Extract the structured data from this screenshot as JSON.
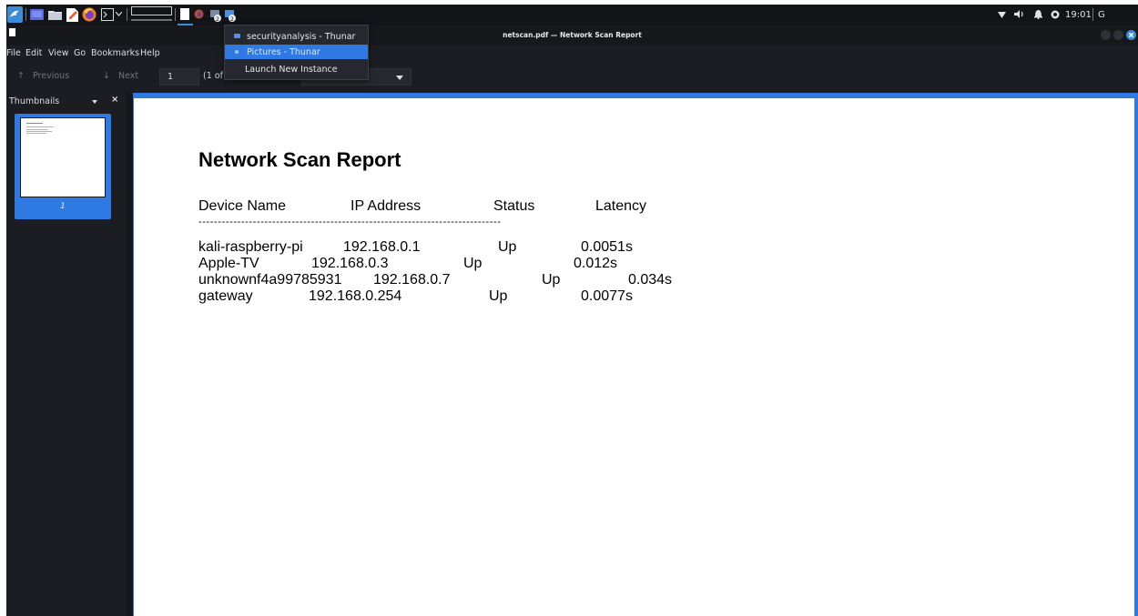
{
  "panel": {
    "clock": "19:01",
    "trailing": "G"
  },
  "task_menu": {
    "items": [
      {
        "label": "securityanalysis - Thunar",
        "selected": false
      },
      {
        "label": "Pictures - Thunar",
        "selected": true
      },
      {
        "label": "Launch New Instance",
        "selected": false
      }
    ]
  },
  "window": {
    "title": "netscan.pdf — Network Scan Report"
  },
  "menubar": [
    "File",
    "Edit",
    "View",
    "Go",
    "Bookmarks",
    "Help"
  ],
  "toolbar": {
    "previous": "Previous",
    "next": "Next",
    "page_value": "1",
    "page_of": "(1 of"
  },
  "sidebar": {
    "title": "Thumbnails",
    "close": "×",
    "page_number": "1"
  },
  "document": {
    "title": "Network Scan Report",
    "header": [
      "Device Name",
      "IP Address",
      "Status",
      "Latency"
    ],
    "separator": "------------------------------------------------------------------------------",
    "rows": [
      [
        "kali-raspberry-pi",
        "192.168.0.1",
        "Up",
        "0.0051s"
      ],
      [
        "Apple-TV",
        "192.168.0.3",
        "Up",
        "0.012s"
      ],
      [
        "unknownf4a99785931",
        "192.168.0.7",
        "Up",
        "0.034s"
      ],
      [
        "gateway",
        "192.168.0.254",
        "Up",
        "0.0077s"
      ]
    ]
  },
  "colors": {
    "accent": "#2f79e2",
    "panel": "#121418",
    "window_bg": "#1b1d22"
  }
}
